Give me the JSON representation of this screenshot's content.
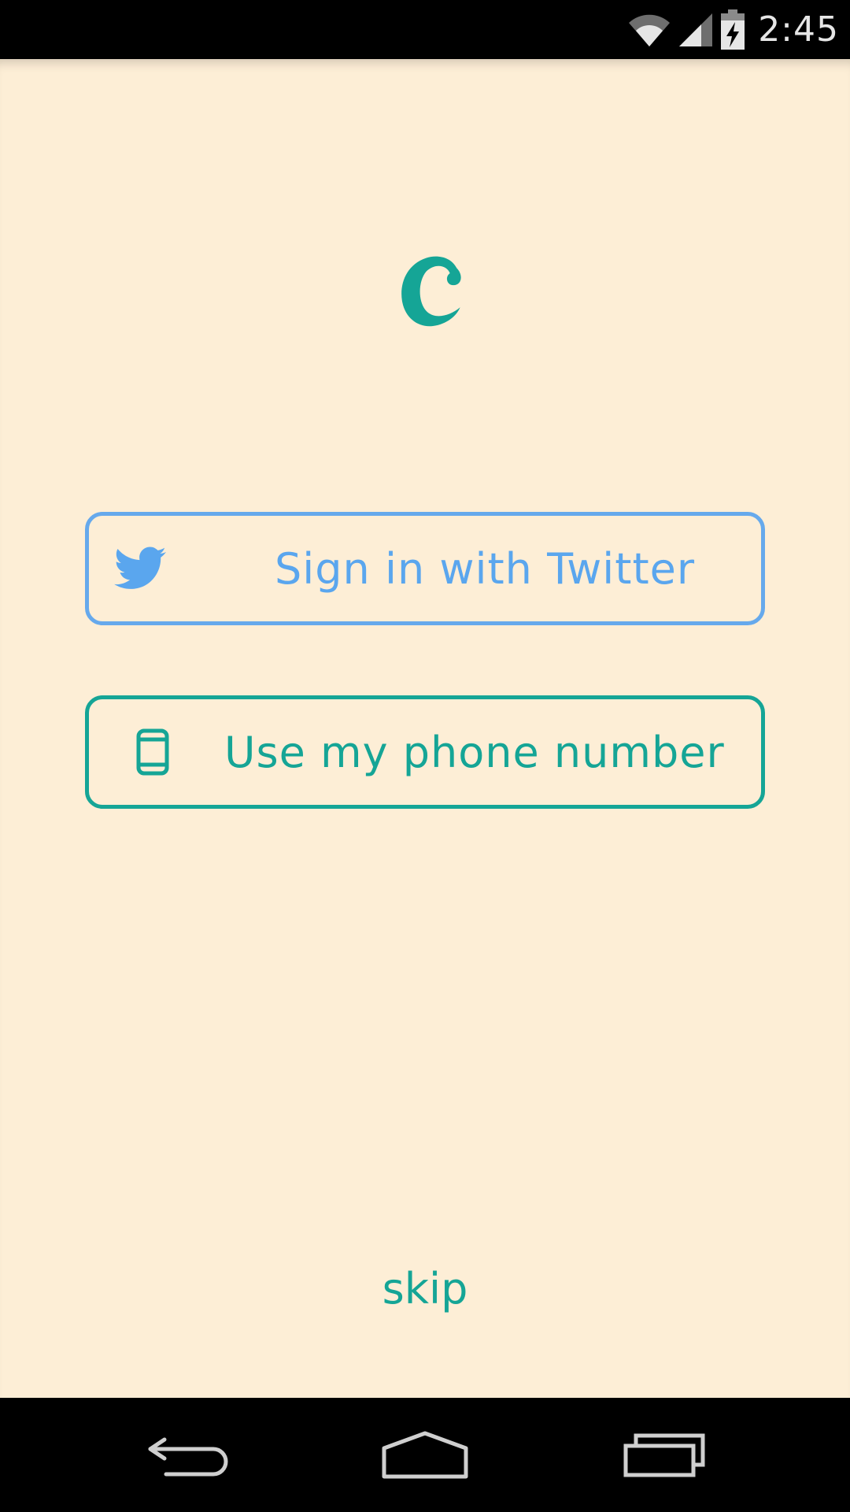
{
  "status_bar": {
    "time": "2:45",
    "icons": [
      "wifi-icon",
      "signal-icon",
      "battery-charging-icon"
    ]
  },
  "app": {
    "logo_icon": "c-logo-icon",
    "accent_color": "#15a596",
    "background_color": "#fdeed6",
    "twitter_button": {
      "label": "Sign in with Twitter",
      "icon": "twitter-bird-icon",
      "color": "#5aa6ee"
    },
    "phone_button": {
      "label": "Use my phone number",
      "icon": "phone-icon",
      "color": "#15a596"
    },
    "skip_label": "skip"
  },
  "nav_bar": {
    "icons": [
      "back-icon",
      "home-icon",
      "recents-icon"
    ]
  }
}
